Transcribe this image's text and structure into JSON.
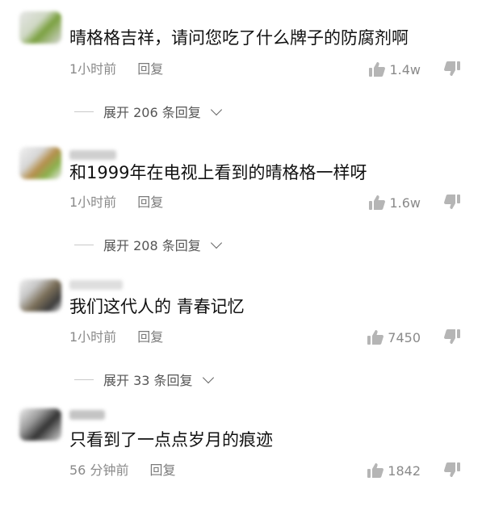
{
  "comments": [
    {
      "text": "晴格格吉祥，请问您吃了什么牌子的防腐剂啊",
      "time": "1小时前",
      "reply_label": "回复",
      "likes": "1.4w",
      "expand": "展开 206 条回复"
    },
    {
      "text": "和1999年在电视上看到的晴格格一样呀",
      "time": "1小时前",
      "reply_label": "回复",
      "likes": "1.6w",
      "expand": "展开 208 条回复"
    },
    {
      "text": "我们这代人的 青春记忆",
      "time": "1小时前",
      "reply_label": "回复",
      "likes": "7450",
      "expand": "展开 33 条回复"
    },
    {
      "text": "只看到了一点点岁月的痕迹",
      "time": "56 分钟前",
      "reply_label": "回复",
      "likes": "1842"
    }
  ],
  "icons": {
    "like": "thumbs-up-icon",
    "dislike": "thumbs-down-icon",
    "expand": "chevron-down-icon"
  },
  "colors": {
    "text": "#111111",
    "meta": "#8a8a8a",
    "icon": "#b5b5b5"
  }
}
